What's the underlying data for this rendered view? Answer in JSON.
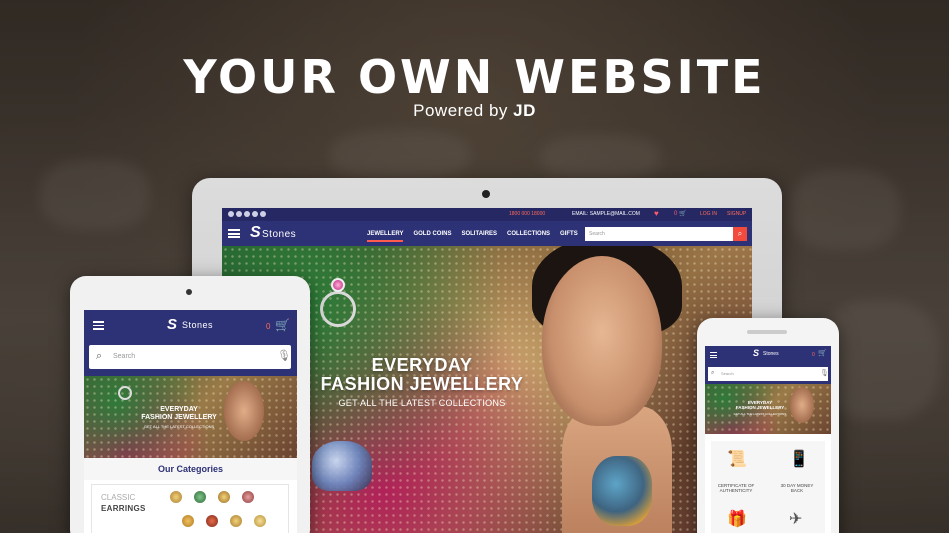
{
  "hero": {
    "headline": "YOUR OWN WEBSITE",
    "powered_by": "Powered by",
    "brand": "JD"
  },
  "desktop": {
    "topbar": {
      "phone": "1800 000 18000",
      "email": "EMAIL: SAMPLE@MAIL.COM",
      "cart_count": "0",
      "login": "LOG IN",
      "signup": "SIGNUP"
    },
    "logo_text": "Stones",
    "nav": [
      "JEWELLERY",
      "GOLD COINS",
      "SOLITAIRES",
      "COLLECTIONS",
      "GIFTS"
    ],
    "search_placeholder": "Search",
    "banner": {
      "line1": "EVERYDAY",
      "line2": "FASHION  JEWELLERY",
      "subtitle": "GET ALL THE LATEST COLLECTIONS"
    }
  },
  "tablet": {
    "logo_text": "Stones",
    "cart_count": "0",
    "search_placeholder": "Search",
    "banner": {
      "line1": "EVERYDAY",
      "line2": "FASHION JEWELLERY",
      "subtitle": "GET ALL THE LATEST COLLECTIONS"
    },
    "categories_title": "Our Categories",
    "category": {
      "subtitle": "CLASSIC",
      "title": "EARRINGS"
    }
  },
  "phone": {
    "logo_text": "Stones",
    "cart_count": "0",
    "search_placeholder": "Search",
    "banner": {
      "line1": "EVERYDAY",
      "line2": "FASHION JEWELLERY",
      "subtitle": "GET ALL THE LATEST COLLECTIONS"
    },
    "features": [
      {
        "icon": "certificate-icon",
        "label": "CERTIFICATE OF AUTHENTICITY"
      },
      {
        "icon": "money-back-icon",
        "label": "30 DAY MONEY BACK"
      }
    ]
  },
  "colors": {
    "navy": "#2d3175",
    "accent": "#f24a3c"
  }
}
